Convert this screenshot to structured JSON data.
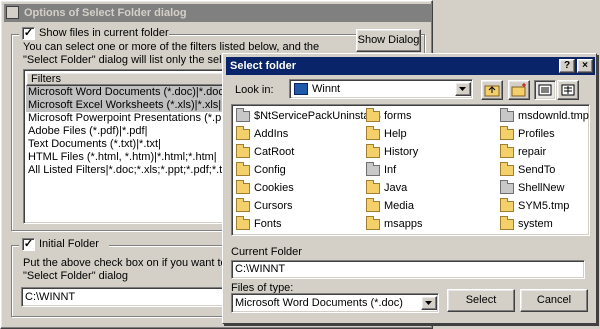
{
  "bg_dialog": {
    "title": "Options of Select Folder dialog",
    "show_files_label": "Show files in current folder",
    "show_dialog_button": "Show Dialog",
    "filters_description": "You can select one or more of the filters listed below, and the \"Select Folder\" dialog will list only the selected file types",
    "filters_header": "Filters",
    "filters": [
      "Microsoft Word Documents (*.doc)|*.doc|",
      "Microsoft Excel Worksheets (*.xls)|*.xls|",
      "Microsoft Powerpoint Presentations (*.ppt)|*.ppt|",
      "Adobe Files (*.pdf)|*.pdf|",
      "Text Documents (*.txt)|*.txt|",
      "HTML Files (*.html, *.htm)|*.html;*.htm|",
      "All Listed Filters|*.doc;*.xls;*.ppt;*.pdf;*.txt;*.html;"
    ],
    "initial_folder_label": "Initial Folder",
    "initial_folder_description": "Put the above check box on if you want to specify \"Select Folder\" dialog",
    "initial_folder_value": "C:\\WINNT",
    "check_mark": "✓"
  },
  "select_dialog": {
    "title": "Select folder",
    "help_glyph": "?",
    "close_glyph": "×",
    "look_in_label": "Look in:",
    "look_in_value": "Winnt",
    "files": [
      {
        "name": "$NtServicePackUninstall$",
        "icon": "gray-folder-icon"
      },
      {
        "name": "AddIns",
        "icon": "folder-icon"
      },
      {
        "name": "CatRoot",
        "icon": "folder-icon"
      },
      {
        "name": "Config",
        "icon": "folder-icon"
      },
      {
        "name": "Cookies",
        "icon": "folder-icon"
      },
      {
        "name": "Cursors",
        "icon": "folder-icon"
      },
      {
        "name": "Fonts",
        "icon": "folder-icon"
      },
      {
        "name": "forms",
        "icon": "folder-icon"
      },
      {
        "name": "Help",
        "icon": "folder-icon"
      },
      {
        "name": "History",
        "icon": "folder-icon"
      },
      {
        "name": "Inf",
        "icon": "gray-folder-icon"
      },
      {
        "name": "Java",
        "icon": "folder-icon"
      },
      {
        "name": "Media",
        "icon": "folder-icon"
      },
      {
        "name": "msapps",
        "icon": "folder-icon"
      },
      {
        "name": "msdownld.tmp",
        "icon": "gray-folder-icon"
      },
      {
        "name": "Profiles",
        "icon": "folder-icon"
      },
      {
        "name": "repair",
        "icon": "folder-icon"
      },
      {
        "name": "SendTo",
        "icon": "folder-icon"
      },
      {
        "name": "ShellNew",
        "icon": "gray-folder-icon"
      },
      {
        "name": "SYM5.tmp",
        "icon": "folder-icon"
      },
      {
        "name": "system",
        "icon": "folder-icon"
      }
    ],
    "current_folder_label": "Current Folder",
    "current_folder_value": "C:\\WINNT",
    "files_of_type_label": "Files of type:",
    "files_of_type_value": "Microsoft Word Documents (*.doc)",
    "select_button": "Select",
    "cancel_button": "Cancel"
  }
}
